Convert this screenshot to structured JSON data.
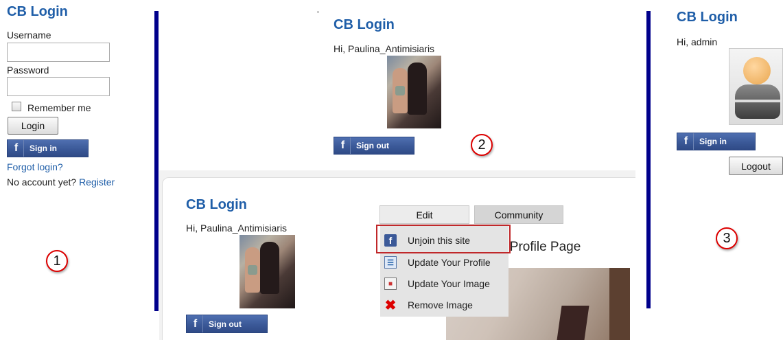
{
  "panel1": {
    "title": "CB Login",
    "username_label": "Username",
    "username_value": "",
    "password_label": "Password",
    "password_value": "",
    "remember_label": "Remember me",
    "remember_checked": false,
    "login_button": "Login",
    "fb_button": "Sign in",
    "forgot_link": "Forgot login?",
    "no_account_text": "No account yet?",
    "register_link": "Register",
    "step_number": "1"
  },
  "panel2": {
    "title": "CB Login",
    "greeting": "Hi, Paulina_Antimisiaris",
    "fb_button": "Sign out",
    "step_number": "2"
  },
  "panel4": {
    "title": "CB Login",
    "greeting": "Hi, Paulina_Antimisiaris",
    "fb_button": "Sign out",
    "tabs": [
      {
        "label": "Edit"
      },
      {
        "label": "Community"
      }
    ],
    "menu": [
      {
        "label": "Unjoin this site",
        "icon": "facebook-icon",
        "highlighted": true
      },
      {
        "label": "Update Your Profile",
        "icon": "profile-edit-icon"
      },
      {
        "label": "Update Your Image",
        "icon": "image-icon"
      },
      {
        "label": "Remove Image",
        "icon": "remove-icon"
      }
    ],
    "heading_partial": "s Profile Page"
  },
  "panel3": {
    "title": "CB Login",
    "greeting": "Hi, admin",
    "fb_button": "Sign in",
    "logout_button": "Logout",
    "step_number": "3"
  },
  "colors": {
    "title_blue": "#1f5ea8",
    "divider_navy": "#00008b",
    "facebook_blue": "#3b5998",
    "highlight_red": "#c0282a"
  }
}
